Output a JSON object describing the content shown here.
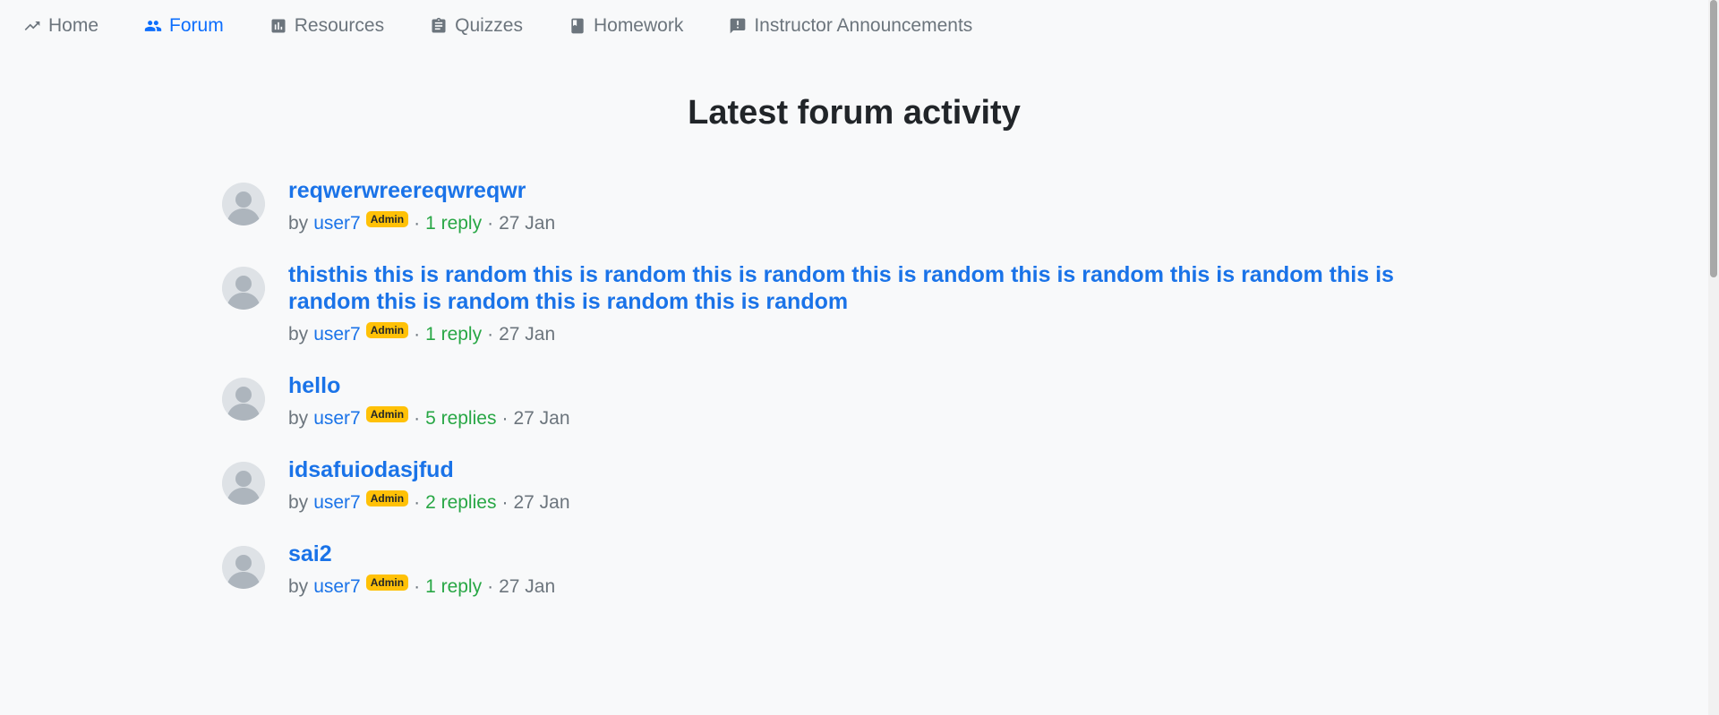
{
  "nav": {
    "items": [
      {
        "label": "Home",
        "icon": "trending-up-icon"
      },
      {
        "label": "Forum",
        "icon": "people-icon",
        "active": true
      },
      {
        "label": "Resources",
        "icon": "bar-chart-icon"
      },
      {
        "label": "Quizzes",
        "icon": "clipboard-icon"
      },
      {
        "label": "Homework",
        "icon": "book-icon"
      },
      {
        "label": "Instructor Announcements",
        "icon": "announcement-icon"
      }
    ]
  },
  "main": {
    "title": "Latest forum activity"
  },
  "threads": [
    {
      "title": "reqwerwreereqwreqwr",
      "by": "by",
      "user": "user7",
      "badge": "Admin",
      "replies": "1 reply",
      "date": "27 Jan"
    },
    {
      "title": "thisthis this is random this is random this is random this is random this is random this is random this is random this is random this is random this is random",
      "by": "by",
      "user": "user7",
      "badge": "Admin",
      "replies": "1 reply",
      "date": "27 Jan"
    },
    {
      "title": "hello",
      "by": "by",
      "user": "user7",
      "badge": "Admin",
      "replies": "5 replies",
      "date": "27 Jan"
    },
    {
      "title": "idsafuiodasjfud",
      "by": "by",
      "user": "user7",
      "badge": "Admin",
      "replies": "2 replies",
      "date": "27 Jan"
    },
    {
      "title": "sai2",
      "by": "by",
      "user": "user7",
      "badge": "Admin",
      "replies": "1 reply",
      "date": "27 Jan"
    }
  ],
  "colors": {
    "accent": "#1a73e8",
    "nav_active": "#0d6efd",
    "replies": "#28a745",
    "badge": "#ffc107",
    "background": "#f8f9fa"
  }
}
